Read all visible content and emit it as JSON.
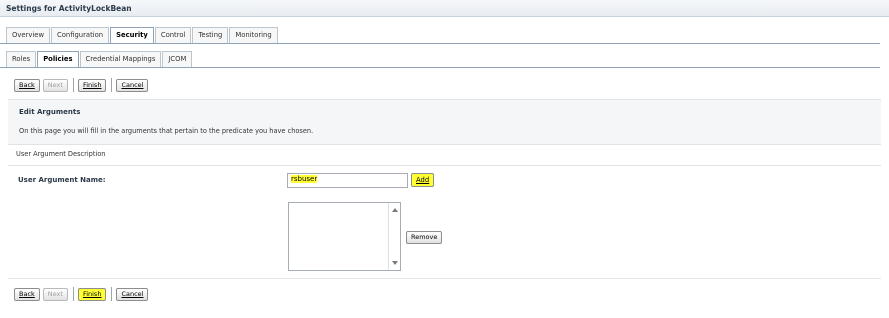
{
  "header": {
    "title": "Settings for ActivityLockBean"
  },
  "main_tabs": [
    {
      "label": "Overview",
      "active": false
    },
    {
      "label": "Configuration",
      "active": false
    },
    {
      "label": "Security",
      "active": true
    },
    {
      "label": "Control",
      "active": false
    },
    {
      "label": "Testing",
      "active": false
    },
    {
      "label": "Monitoring",
      "active": false
    }
  ],
  "sub_tabs": [
    {
      "label": "Roles",
      "active": false
    },
    {
      "label": "Policies",
      "active": true
    },
    {
      "label": "Credential Mappings",
      "active": false
    },
    {
      "label": "JCOM",
      "active": false
    }
  ],
  "wizard_buttons": {
    "back": "Back",
    "next": "Next",
    "finish": "Finish",
    "cancel": "Cancel"
  },
  "section": {
    "heading": "Edit Arguments",
    "description": "On this page you will fill in the arguments that pertain to the predicate you have chosen."
  },
  "argument": {
    "description_label": "User Argument Description",
    "name_label": "User Argument Name:",
    "name_value": "rsbuser",
    "add_label": "Add",
    "remove_label": "Remove",
    "list_values": []
  },
  "highlight_color": "#ffff33"
}
